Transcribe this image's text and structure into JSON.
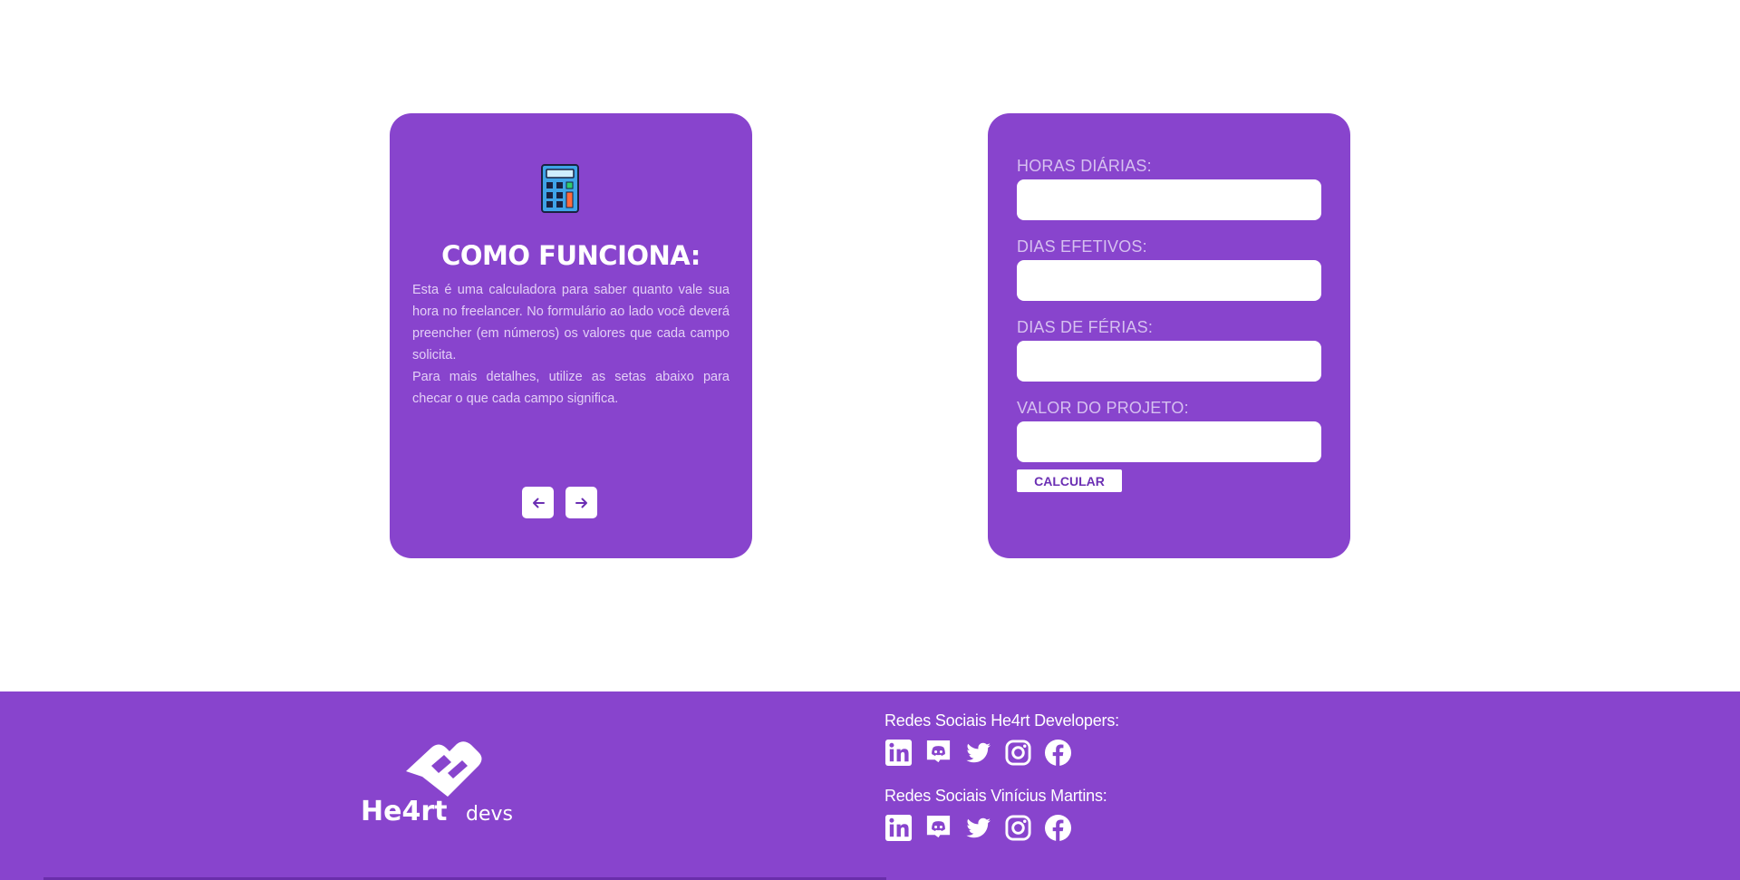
{
  "info": {
    "icon": "calculator-icon",
    "title": "COMO FUNCIONA:",
    "paragraph1": "Esta é uma calculadora para saber quanto vale sua hora no freelancer. No formulário ao lado você deverá preencher (em números) os valores que cada campo solicita.",
    "paragraph2": "Para mais detalhes, utilize as setas abaixo para checar o que cada campo significa.",
    "prev_icon": "arrow-left-icon",
    "next_icon": "arrow-right-icon"
  },
  "form": {
    "fields": [
      {
        "label": "HORAS DIÁRIAS:",
        "value": ""
      },
      {
        "label": "DIAS EFETIVOS:",
        "value": ""
      },
      {
        "label": "DIAS DE FÉRIAS:",
        "value": ""
      },
      {
        "label": "VALOR DO PROJETO:",
        "value": ""
      }
    ],
    "submit_label": "CALCULAR"
  },
  "footer": {
    "logo_text": "He4rt devs",
    "group1": {
      "title": "Redes Sociais He4rt Developers:",
      "icons": [
        "linkedin-icon",
        "discord-icon",
        "twitter-icon",
        "instagram-icon",
        "facebook-icon"
      ]
    },
    "group2": {
      "title": "Redes Sociais Vinícius Martins:",
      "icons": [
        "linkedin-icon",
        "discord-icon",
        "twitter-icon",
        "instagram-icon",
        "facebook-icon"
      ]
    }
  },
  "colors": {
    "brand_purple": "#8844cd",
    "label_lavender": "#d6c0f0",
    "white": "#ffffff"
  }
}
